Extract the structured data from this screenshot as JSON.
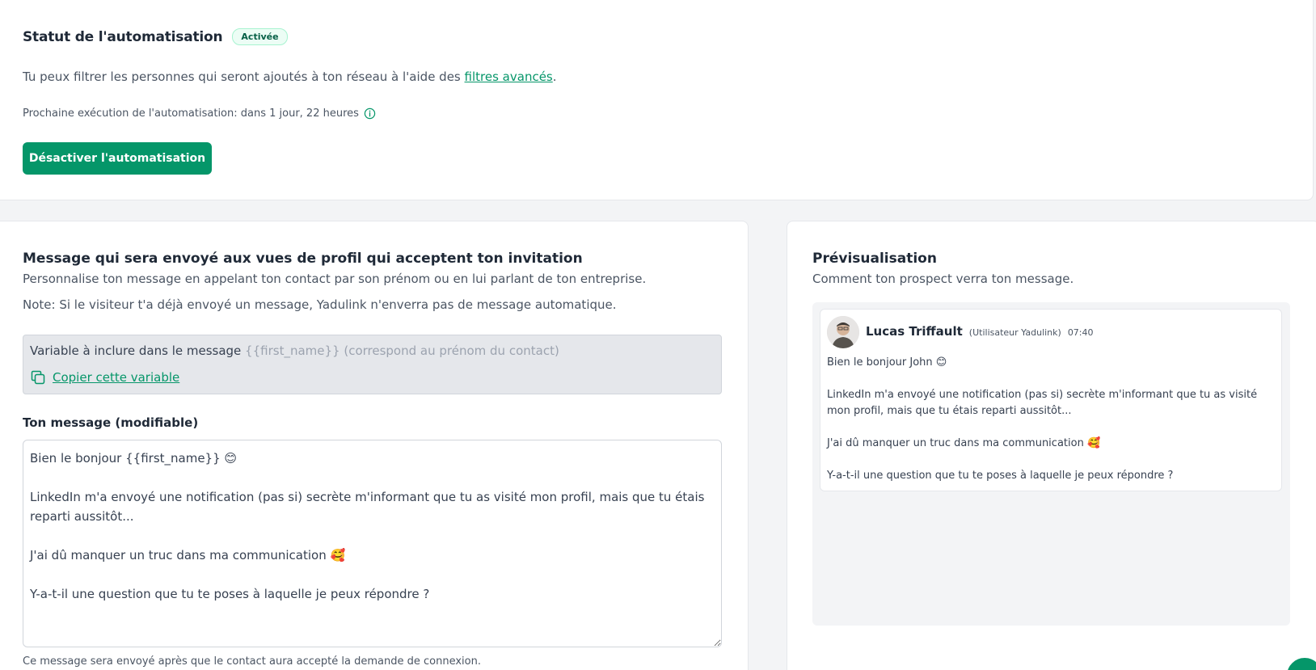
{
  "status": {
    "title": "Statut de l'automatisation",
    "badge": "Activée"
  },
  "filter": {
    "text_before": "Tu peux filtrer les personnes qui seront ajoutés à ton réseau à l'aide des ",
    "link": "filtres avancés",
    "text_after": "."
  },
  "next_run": {
    "text": "Prochaine exécution de l'automatisation: dans 1 jour, 22 heures",
    "icon": "info-icon"
  },
  "deactivate_button": "Désactiver l'automatisation",
  "message_section": {
    "title": "Message qui sera envoyé aux vues de profil qui acceptent ton invitation",
    "subtitle": "Personnalise ton message en appelant ton contact par son prénom ou en lui parlant de ton entreprise.",
    "note": "Note: Si le visiteur t'a déjà envoyé un message, Yadulink n'enverra pas de message automatique.",
    "variable_label": "Variable à inclure dans le message ",
    "variable_name": "{{first_name}}",
    "variable_desc": " (correspond au prénom du contact)",
    "copy_icon": "copy-icon",
    "copy_link": "Copier cette variable",
    "field_label": "Ton message (modifiable)",
    "message_value": "Bien le bonjour {{first_name}} 😊\n\nLinkedIn m'a envoyé une notification (pas si) secrète m'informant que tu as visité mon profil, mais que tu étais reparti aussitôt...\n\nJ'ai dû manquer un truc dans ma communication 🥰\n\nY-a-t-il une question que tu te poses à laquelle je peux répondre ?",
    "hint": "Ce message sera envoyé après que le contact aura accepté la demande de connexion."
  },
  "preview": {
    "title": "Prévisualisation",
    "subtitle": "Comment ton prospect verra ton message.",
    "sender_name": "Lucas Triffault",
    "sender_role": "(Utilisateur Yadulink)",
    "time": "07:40",
    "body": "Bien le bonjour John 😊\n\nLinkedIn m'a envoyé une notification (pas si) secrète m'informant que tu as visité mon profil, mais que tu étais reparti aussitôt...\n\nJ'ai dû manquer un truc dans ma communication 🥰\n\nY-a-t-il une question que tu te poses à laquelle je peux répondre ?"
  },
  "colors": {
    "accent": "#059669",
    "badge_bg": "#ecfdf5",
    "panel_bg": "#f3f4f6"
  }
}
